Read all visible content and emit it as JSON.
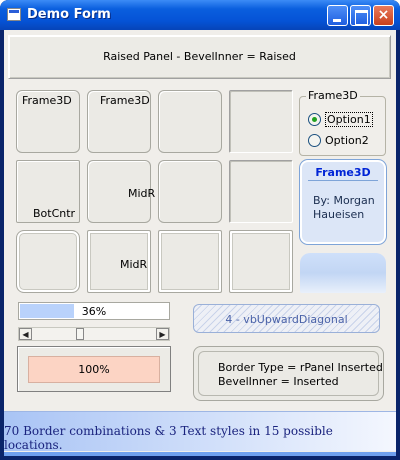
{
  "window": {
    "title": "Demo Form",
    "close_glyph": "×"
  },
  "panel": {
    "text": "Raised Panel - BevelInner = Raised"
  },
  "frames": {
    "r1c1": "Frame3D",
    "r1c2": "Frame3D",
    "r2c1": "BotCntr",
    "r2c2": "MidR",
    "r3c2": "MidR"
  },
  "options": {
    "legend": "Frame3D",
    "items": [
      {
        "label": "Option1",
        "selected": true
      },
      {
        "label": "Option2",
        "selected": false
      }
    ]
  },
  "card": {
    "title": "Frame3D",
    "body": "By: Morgan Haueisen"
  },
  "progress": {
    "text": "36%",
    "value": 36
  },
  "scrollbar": {
    "left_glyph": "◀",
    "right_glyph": "▶"
  },
  "percent_box": {
    "text": "100%"
  },
  "hatch": {
    "text": "4 - vbUpwardDiagonal"
  },
  "border_box": {
    "line1": "Border Type = rPanel Inserted",
    "line2": "BevelInner = Inserted"
  },
  "status": {
    "text": "70 Border combinations & 3 Text styles in 15 possible locations."
  },
  "colors": {
    "titlebar": "#0553d6",
    "card_title": "#0024d6",
    "status_text": "#1a237e",
    "percent_fill": "#fcd4c4",
    "progress_fill": "#b9d2fb"
  }
}
